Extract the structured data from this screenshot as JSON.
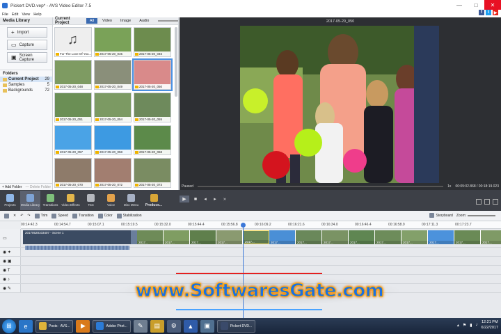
{
  "window": {
    "title": "Pickert DVD.vep* - AVS Video Editor 7.5",
    "controls": [
      "—",
      "□",
      "✕"
    ]
  },
  "menu": [
    "File",
    "Edit",
    "View",
    "Help"
  ],
  "social": [
    {
      "name": "facebook",
      "label": "f",
      "color": "#3b5998"
    },
    {
      "name": "twitter",
      "label": "t",
      "color": "#1da1f2"
    },
    {
      "name": "youtube",
      "label": "▶",
      "color": "#e62117"
    }
  ],
  "media_library": {
    "title": "Media Library",
    "buttons": [
      "Import",
      "Capture",
      "Screen Capture"
    ],
    "folders_title": "Folders",
    "folders": [
      {
        "name": "Current Project",
        "count": "29"
      },
      {
        "name": "Samples",
        "count": "5"
      },
      {
        "name": "Backgrounds",
        "count": "72"
      }
    ],
    "add_folder": "+ Add Folder",
    "delete_folder": "— Delete Folder"
  },
  "current_project": {
    "title": "Current Project",
    "tabs": [
      "All",
      "Video",
      "Image",
      "Audio"
    ],
    "thumbs": [
      {
        "label": "For The Love Of You...",
        "color": "#eeeeee",
        "note": true
      },
      {
        "label": "2017-05-20_045",
        "color": "#7aa258"
      },
      {
        "label": "2017-05-20_046",
        "color": "#6d8c4e"
      },
      {
        "label": "2017-05-20_048",
        "color": "#7e9b62"
      },
      {
        "label": "2017-05-20_049",
        "color": "#8a8f7a"
      },
      {
        "label": "2017-05-20_050",
        "color": "#d98a8a"
      },
      {
        "label": "2017-05-20_051",
        "color": "#6b8f55"
      },
      {
        "label": "2017-05-20_054",
        "color": "#7c9a63"
      },
      {
        "label": "2017-05-20_055",
        "color": "#6e8a5c"
      },
      {
        "label": "2017-05-20_057",
        "color": "#4aa3e6"
      },
      {
        "label": "2017-05-20_058",
        "color": "#3d9ae2"
      },
      {
        "label": "2017-05-20_068",
        "color": "#5c8a4a"
      },
      {
        "label": "2017-05-20_070",
        "color": "#8e7b6a"
      },
      {
        "label": "2017-05-20_072",
        "color": "#a27e70"
      },
      {
        "label": "2017-05-20_073",
        "color": "#7a8c62"
      }
    ]
  },
  "preview": {
    "clip_title": "2017-05-20_050",
    "status": "Paused",
    "speed": "1x",
    "time": "00:09:02.868 / 00:18:19.023"
  },
  "toolbar": {
    "tools": [
      {
        "label": "Projects",
        "color": "#8fb7e8"
      },
      {
        "label": "Media Library",
        "color": "#7ea3d6"
      },
      {
        "label": "Transitions",
        "color": "#7fc07b"
      },
      {
        "label": "Video Effects",
        "color": "#e3b64b"
      },
      {
        "label": "Text",
        "color": "#b5b8be"
      },
      {
        "label": "Voice",
        "color": "#e3a24b"
      },
      {
        "label": "Disc Menu",
        "color": "#a6b0c4"
      }
    ],
    "produce": "Produce..."
  },
  "timeline_toolbar": {
    "buttons": [
      "Trim",
      "Speed",
      "Transition",
      "Color",
      "Stabilization"
    ],
    "storyboard": "Storyboard",
    "zoom": "Zoom:"
  },
  "ruler": [
    "00:14:42.3",
    "00:14:54.7",
    "00:15:07.1",
    "00:15:19.5",
    "00:15:32.0",
    "00:15:44.4",
    "00:15:56.8",
    "00:16:09.2",
    "00:16:21.6",
    "00:16:34.0",
    "00:16:46.4",
    "00:16:58.9",
    "00:17:11.3",
    "00:17:23.7"
  ],
  "timeline": {
    "main_clip_label": "20170528103407 - Scene 1",
    "clip_label": "2017..."
  },
  "watermark": "www.SoftwaresGate.com",
  "taskbar": {
    "apps": [
      {
        "label": "Posts · AVS...",
        "color": "#e0b43a"
      },
      {
        "label": "Adobe Phot...",
        "color": "#2b7bd6"
      },
      {
        "label": "Pickert DVD...",
        "color": "#3a4a6a"
      }
    ],
    "time": "12:21 PM",
    "date": "6/22/2017"
  }
}
